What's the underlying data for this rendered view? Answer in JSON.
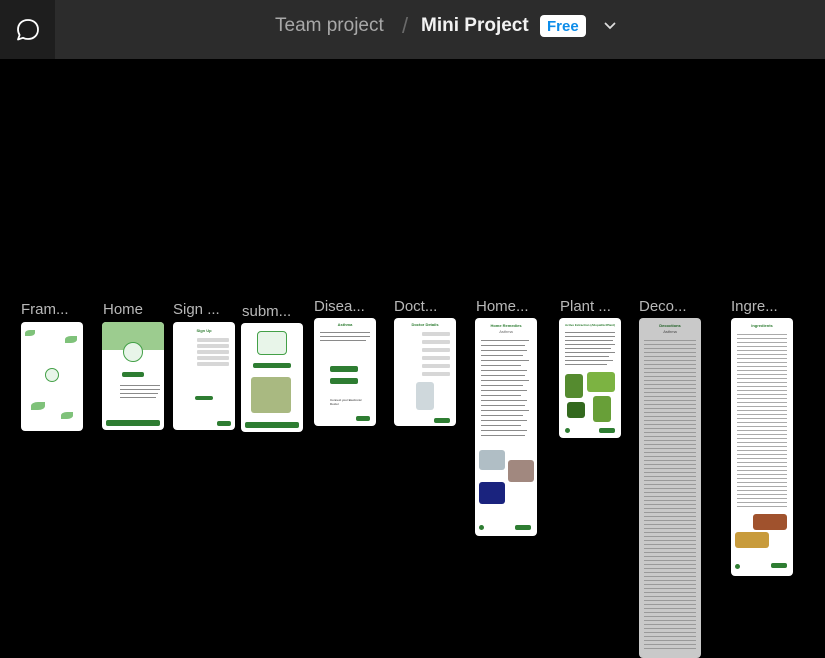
{
  "topbar": {
    "team": "Team project",
    "separator": "/",
    "project": "Mini Project",
    "plan_badge": "Free"
  },
  "frames": [
    {
      "label": "Fram..."
    },
    {
      "label": "Home"
    },
    {
      "label": "Sign ..."
    },
    {
      "label": "subm..."
    },
    {
      "label": "Disea..."
    },
    {
      "label": "Doct..."
    },
    {
      "label": "Home..."
    },
    {
      "label": "Plant ..."
    },
    {
      "label": "Deco..."
    },
    {
      "label": "Ingre..."
    }
  ],
  "frame_text": {
    "signup_title": "Sign Up",
    "asthma_title": "Asthma",
    "doctor_title": "Doctor Details",
    "remedies_title": "Home Remedies",
    "remedies_sub": "Asthma",
    "plant_title": "Active Extraction (Allopathic/Plant)",
    "decoction_title": "Decoctions",
    "decoction_sub": "Asthma",
    "ingredients_title": "Ingredients",
    "connect_doctor": "Connect your Electronic Doctor"
  }
}
